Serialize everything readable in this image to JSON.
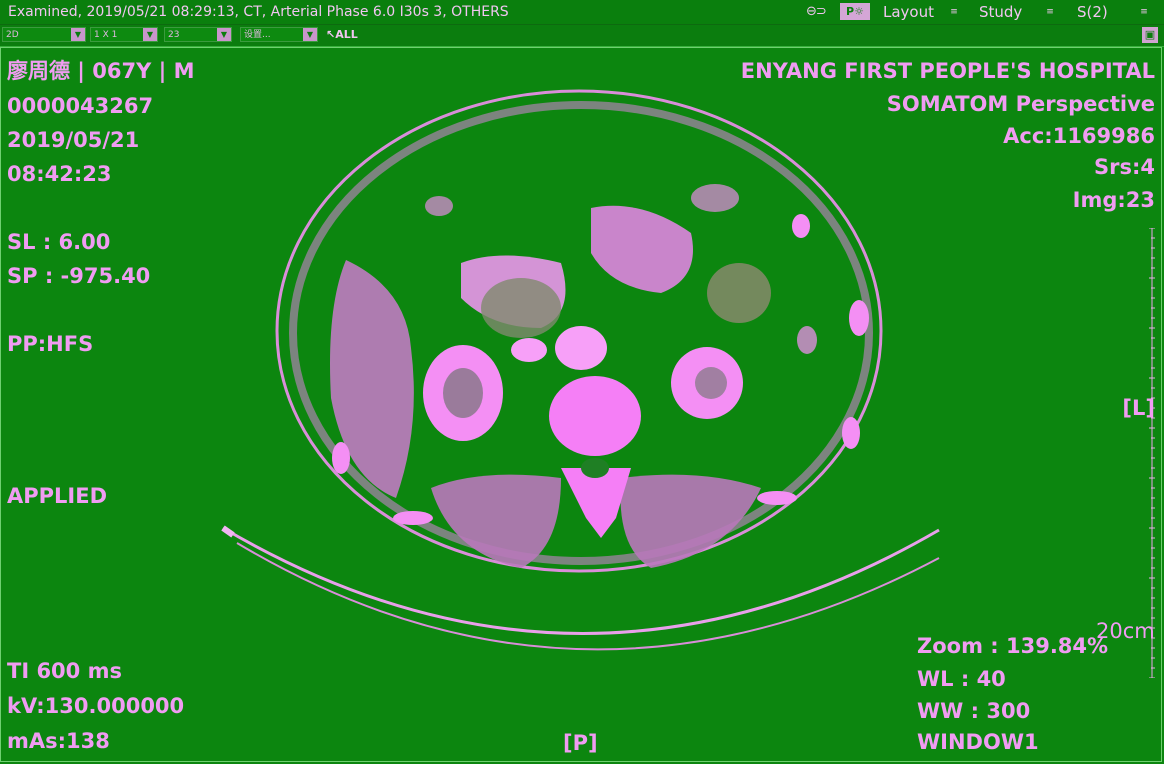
{
  "titlebar": {
    "title": "Examined, 2019/05/21 08:29:13, CT, Arterial Phase  6.0  I30s  3, OTHERS",
    "link_icon": "link-icon",
    "pq_label": "P",
    "layout": "Layout",
    "study": "Study",
    "series": "S(2)"
  },
  "toolbar": {
    "mode": "2D",
    "grid": "1 X 1",
    "image": "23",
    "preset": "设置...",
    "all_label": "ALL"
  },
  "overlay": {
    "patient_name": "廖周德",
    "age": "067Y",
    "sex": "M",
    "patient_id": "0000043267",
    "date": "2019/05/21",
    "time": "08:42:23",
    "sl": "SL : 6.00",
    "sp": "SP : -975.40",
    "pp": "PP:HFS",
    "applied": "APPLIED",
    "ti": "TI 600 ms",
    "kv": "kV:130.000000",
    "mas": "mAs:138",
    "hospital": "ENYANG FIRST PEOPLE'S HOSPITAL",
    "scanner": "SOMATOM Perspective",
    "acc": "Acc:1169986",
    "srs": "Srs:4",
    "img": "Img:23",
    "orient_left": "[L]",
    "orient_bottom": "[P]",
    "scale": "20cm",
    "zoom": "Zoom : 139.84%",
    "wl": "WL : 40",
    "ww": "WW : 300",
    "window": "WINDOW1"
  },
  "colors": {
    "background": "#0c860f",
    "overlay_text": "#f09cf2",
    "tissue": "#d98ed9",
    "bone": "#f48ff4"
  }
}
